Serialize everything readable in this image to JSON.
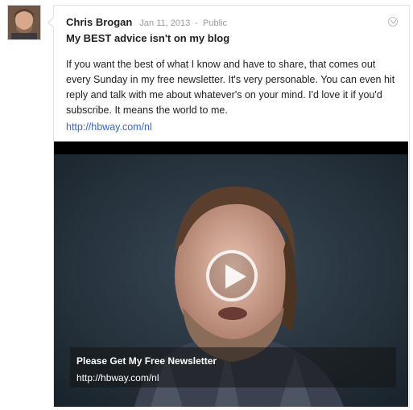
{
  "post": {
    "author": "Chris Brogan",
    "date": "Jan 11, 2013",
    "separator": "-",
    "visibility": "Public",
    "title": "My BEST advice isn't on my blog",
    "body": "If you want the best of what I know and have to share, that comes out every Sunday in my free newsletter. It's very personable. You can even hit reply and talk with me about whatever's on your mind. I'd love it if you'd subscribe. It means the world to me.",
    "link": "http://hbway.com/nl"
  },
  "video": {
    "caption_title": "Please Get My Free Newsletter",
    "caption_url": "http://hbway.com/nl",
    "play_icon": "play-icon"
  },
  "icons": {
    "menu": "chevron-down-icon"
  }
}
